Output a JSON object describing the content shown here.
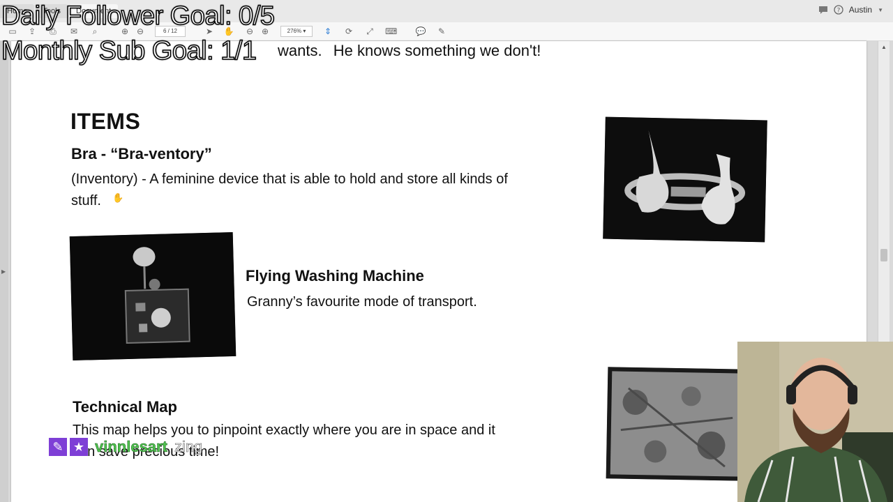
{
  "window": {
    "tabs": [
      "Home",
      "Tools",
      "Document"
    ],
    "user": "Austin"
  },
  "toolbar": {
    "page_current": "6",
    "page_total": "12",
    "zoom": "276%"
  },
  "document": {
    "top_line": "... wants.  He knows something we don't!",
    "top_line_visible": "He knows something we don't!",
    "top_line_partial": "wants.",
    "section_heading": "ITEMS",
    "items": [
      {
        "title": "Bra - “Bra-ventory”",
        "body_line1": "(Inventory) - A feminine device that is able to hold and store all kinds of",
        "body_line2": "stuff."
      },
      {
        "title": "Flying Washing Machine",
        "body_line1": "Granny’s favourite mode of transport."
      },
      {
        "title": "Technical Map",
        "body_line1": "This map helps you to pinpoint exactly where you are in space and it",
        "body_line2": "can save precious time!"
      }
    ]
  },
  "overlay": {
    "goal_daily": "Daily Follower Goal: 0/5",
    "goal_monthly": "Monthly Sub Goal: 1/1",
    "alert_name": "vinnlesart",
    "alert_msg": "zing"
  },
  "colors": {
    "accent": "#2a7bd4",
    "alert_purple": "#7e3fd6",
    "alert_green": "#4fc24f"
  },
  "icons": [
    "save-icon",
    "upload-icon",
    "print-icon",
    "mail-icon",
    "search-icon",
    "page-up-icon",
    "page-down-icon",
    "pointer-icon",
    "hand-icon",
    "zoom-out-icon",
    "zoom-in-icon",
    "fit-page-icon",
    "comment-icon",
    "pen-icon",
    "chat-icon",
    "help-icon"
  ]
}
